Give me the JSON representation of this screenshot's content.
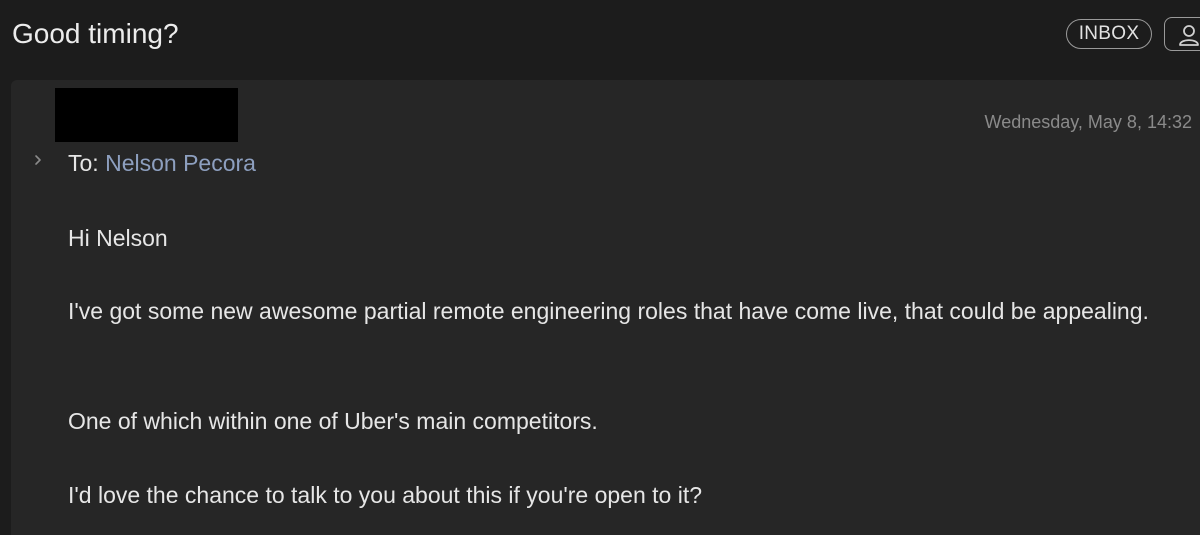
{
  "header": {
    "subject": "Good timing?",
    "mailbox_badge": "INBOX",
    "contact_icon": "person-icon"
  },
  "message": {
    "date": "Wednesday, May 8, 14:32",
    "to_label": "To:",
    "to_name": "Nelson Pecora",
    "body": [
      "Hi Nelson",
      "I've got some new awesome partial remote engineering roles that have come live, that could be appealing.",
      "One of which within one of Uber's main competitors.",
      "I'd love the chance to talk to you about this if you're open to it?"
    ]
  },
  "colors": {
    "background": "#1c1c1c",
    "card": "#262626",
    "recipient_link": "#8d9fbf",
    "muted_text": "#8a8a8a"
  }
}
